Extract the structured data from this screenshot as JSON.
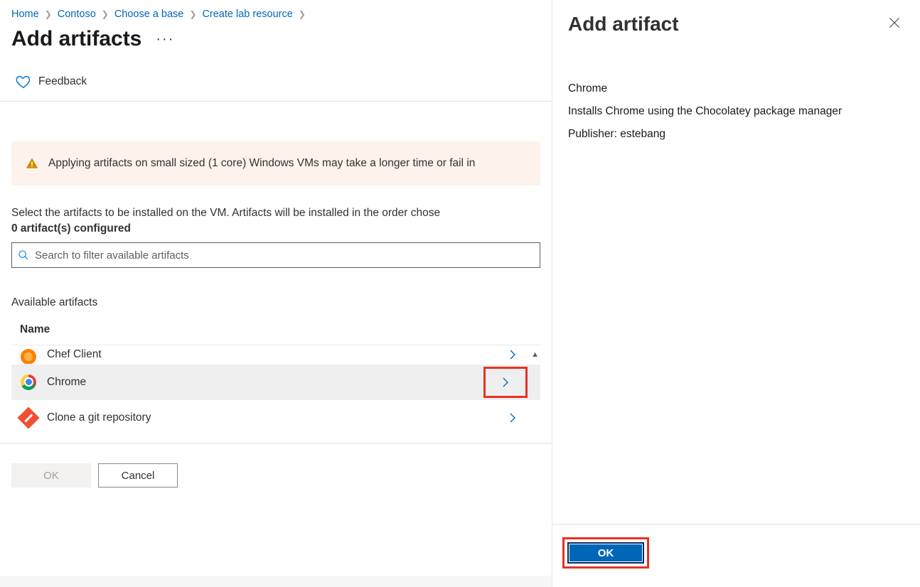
{
  "breadcrumb": [
    {
      "label": "Home"
    },
    {
      "label": "Contoso"
    },
    {
      "label": "Choose a base"
    },
    {
      "label": "Create lab resource"
    }
  ],
  "page": {
    "title": "Add artifacts",
    "feedback": "Feedback",
    "warning": "Applying artifacts on small sized (1 core) Windows VMs may take a longer time or fail in",
    "instruction": "Select the artifacts to be installed on the VM. Artifacts will be installed in the order chose",
    "configured_line": "0 artifact(s) configured",
    "search_placeholder": "Search to filter available artifacts",
    "available_heading": "Available artifacts",
    "col_name": "Name",
    "ok": "OK",
    "cancel": "Cancel"
  },
  "artifacts": [
    {
      "name": "Chef Client",
      "icon": "chef",
      "partial": true
    },
    {
      "name": "Chrome",
      "icon": "chrome",
      "selected": true,
      "highlight_chevron": true
    },
    {
      "name": "Clone a git repository",
      "icon": "git"
    }
  ],
  "panel": {
    "title": "Add artifact",
    "name": "Chrome",
    "description": "Installs Chrome using the Chocolatey package manager",
    "publisher_line": "Publisher: estebang",
    "ok": "OK"
  }
}
